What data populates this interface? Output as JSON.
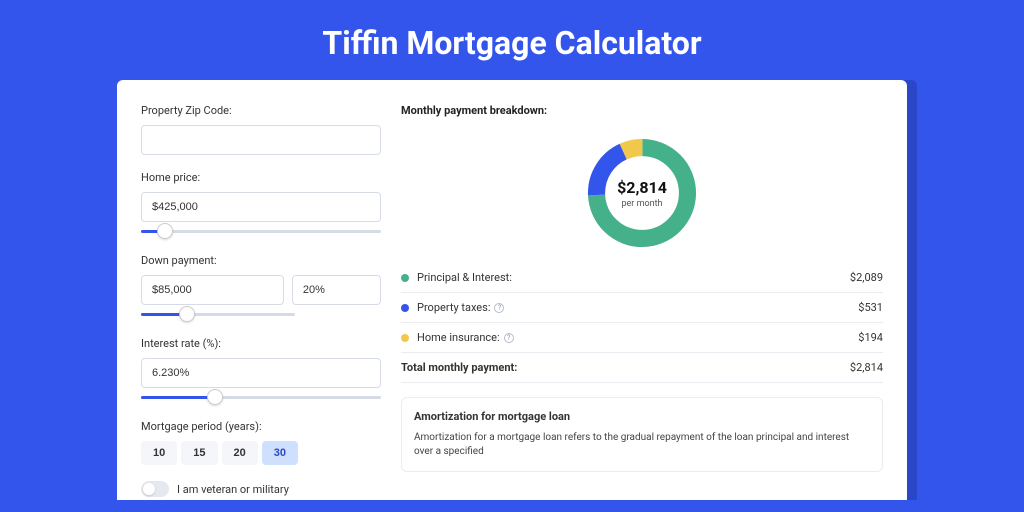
{
  "page": {
    "title": "Tiffin Mortgage Calculator"
  },
  "form": {
    "zip": {
      "label": "Property Zip Code:",
      "value": ""
    },
    "homePrice": {
      "label": "Home price:",
      "value": "$425,000",
      "slider": {
        "pct": 10
      }
    },
    "downPayment": {
      "label": "Down payment:",
      "amount": "$85,000",
      "percent": "20%",
      "slider": {
        "pct": 20
      }
    },
    "interest": {
      "label": "Interest rate (%):",
      "value": "6.230%",
      "slider": {
        "pct": 31
      }
    },
    "period": {
      "label": "Mortgage period (years):",
      "options": [
        {
          "label": "10",
          "value": 10,
          "active": false
        },
        {
          "label": "15",
          "value": 15,
          "active": false
        },
        {
          "label": "20",
          "value": 20,
          "active": false
        },
        {
          "label": "30",
          "value": 30,
          "active": true
        }
      ]
    },
    "veteran": {
      "label": "I am veteran or military",
      "checked": false
    }
  },
  "breakdown": {
    "title": "Monthly payment breakdown:",
    "centerAmount": "$2,814",
    "centerSub": "per month",
    "items": [
      {
        "key": "pi",
        "label": "Principal & Interest:",
        "value": "$2,089",
        "numeric": 2089,
        "color": "#44b18b",
        "info": false
      },
      {
        "key": "tax",
        "label": "Property taxes:",
        "value": "$531",
        "numeric": 531,
        "color": "#3455eb",
        "info": true
      },
      {
        "key": "ins",
        "label": "Home insurance:",
        "value": "$194",
        "numeric": 194,
        "color": "#f2c84b",
        "info": true
      }
    ],
    "totalLabel": "Total monthly payment:",
    "totalValue": "$2,814"
  },
  "amortization": {
    "title": "Amortization for mortgage loan",
    "text": "Amortization for a mortgage loan refers to the gradual repayment of the loan principal and interest over a specified"
  },
  "chart_data": {
    "type": "pie",
    "title": "Monthly payment breakdown",
    "categories": [
      "Principal & Interest",
      "Property taxes",
      "Home insurance"
    ],
    "values": [
      2089,
      531,
      194
    ],
    "colors": [
      "#44b18b",
      "#3455eb",
      "#f2c84b"
    ],
    "center_label": "$2,814 per month",
    "total": 2814
  }
}
